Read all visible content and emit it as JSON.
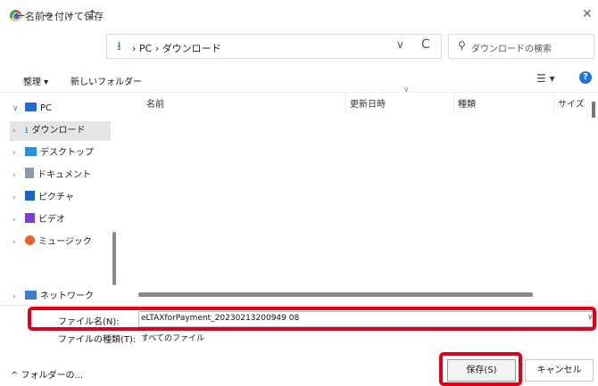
{
  "window": {
    "title": "名前を付けて保存",
    "close_glyph": "✕"
  },
  "nav": {
    "back": "←",
    "forward": "→",
    "recent": "∨",
    "up": "↑",
    "breadcrumb": "› PC › ダウンロード",
    "address_icon": "download-arrow-icon",
    "dropdown": "∨",
    "refresh": "C",
    "search_placeholder": "ダウンロードの検索",
    "search_glyph": "⚲"
  },
  "toolbar": {
    "organize": "整理 ▾",
    "new_folder": "新しいフォルダー",
    "view": "☰ ▾",
    "help": "?"
  },
  "sidebar": {
    "items": [
      {
        "chevron": "∨",
        "label": "PC",
        "selected": false
      },
      {
        "chevron": "›",
        "label": "ダウンロード",
        "selected": true
      },
      {
        "chevron": "›",
        "label": "デスクトップ",
        "selected": false
      },
      {
        "chevron": "›",
        "label": "ドキュメント",
        "selected": false
      },
      {
        "chevron": "›",
        "label": "ピクチャ",
        "selected": false
      },
      {
        "chevron": "›",
        "label": "ビデオ",
        "selected": false
      },
      {
        "chevron": "›",
        "label": "ミュージック",
        "selected": false
      },
      {
        "chevron": "›",
        "label": "ネットワーク",
        "selected": false
      }
    ]
  },
  "columns": {
    "name": "名前",
    "date": "更新日時",
    "type": "種類",
    "size": "サイズ"
  },
  "form": {
    "filename_label": "ファイル名(N):",
    "filename_value": "eLTAXforPayment_20230213200949 08",
    "filetype_label": "ファイルの種類(T):",
    "filetype_value": "すべてのファイル"
  },
  "footer": {
    "folder_toggle": "^ フォルダーの...",
    "save": "保存(S)",
    "cancel": "キャンセル"
  },
  "colors": {
    "highlight_red": "#e0001a",
    "accent_blue": "#1a73e8"
  }
}
